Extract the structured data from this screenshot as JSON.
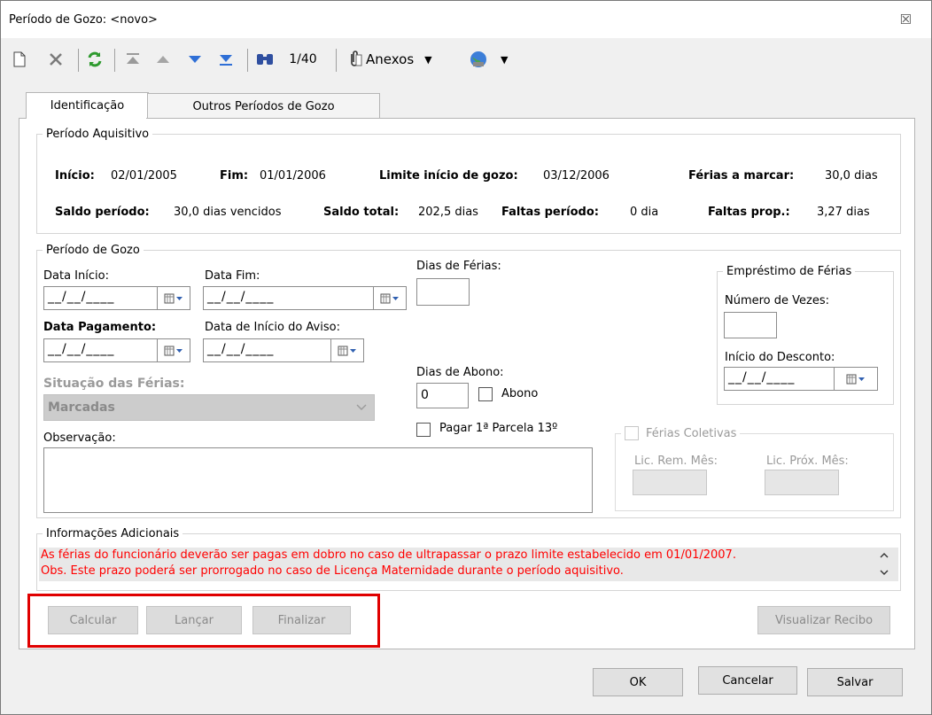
{
  "window": {
    "title": "Período de Gozo: <novo>",
    "close_glyph": "☒"
  },
  "toolbar": {
    "new_icon": "new-document-icon",
    "record_counter": "1/40",
    "anexos_label": "Anexos",
    "dropdown_glyph": "▼"
  },
  "tabs": [
    {
      "label": "Identificação",
      "active": true
    },
    {
      "label": "Outros Períodos de Gozo",
      "active": false
    }
  ],
  "periodo_aquisitivo": {
    "legend": "Período Aquisitivo",
    "inicio_label": "Início:",
    "inicio_value": "02/01/2005",
    "fim_label": "Fim:",
    "fim_value": "01/01/2006",
    "limite_label": "Limite início de gozo:",
    "limite_value": "03/12/2006",
    "ferias_marcar_label": "Férias a marcar:",
    "ferias_marcar_value": "30,0 dias",
    "saldo_periodo_label": "Saldo período:",
    "saldo_periodo_value": "30,0 dias vencidos",
    "saldo_total_label": "Saldo total:",
    "saldo_total_value": "202,5 dias",
    "faltas_periodo_label": "Faltas período:",
    "faltas_periodo_value": "0 dia",
    "faltas_prop_label": "Faltas prop.:",
    "faltas_prop_value": "3,27 dias"
  },
  "periodo_gozo": {
    "legend": "Período de Gozo",
    "data_inicio_label": "Data Início:",
    "data_fim_label": "Data Fim:",
    "date_mask": "__/__/____",
    "data_pagamento_label": "Data Pagamento:",
    "data_aviso_label": "Data de Início do Aviso:",
    "situacao_label": "Situação das Férias:",
    "situacao_value": "Marcadas",
    "observacao_label": "Observação:",
    "dias_ferias_label": "Dias de Férias:",
    "dias_abono_label": "Dias de Abono:",
    "dias_abono_value": "0",
    "abono_label": "Abono",
    "pagar_parcela_label": "Pagar 1ª Parcela 13º",
    "emprestimo_legend": "Empréstimo de Férias",
    "numero_vezes_label": "Número de Vezes:",
    "inicio_desconto_label": "Início do Desconto:",
    "ferias_coletivas_label": "Férias Coletivas",
    "lic_rem_label": "Lic. Rem. Mês:",
    "lic_prox_label": "Lic. Próx. Mês:"
  },
  "informacoes": {
    "legend": "Informações Adicionais",
    "line1": "As férias do funcionário deverão ser pagas em dobro no caso de ultrapassar o prazo limite estabelecido em 01/01/2007.",
    "line2": "Obs. Este prazo poderá ser prorrogado no caso de Licença Maternidade durante o período aquisitivo."
  },
  "actions": {
    "calcular": "Calcular",
    "lancar": "Lançar",
    "finalizar": "Finalizar",
    "visualizar_recibo": "Visualizar Recibo"
  },
  "footer": {
    "ok": "OK",
    "cancelar": "Cancelar",
    "salvar": "Salvar"
  },
  "colors": {
    "alert_text": "#ff0000",
    "highlight_box": "#e00000"
  }
}
